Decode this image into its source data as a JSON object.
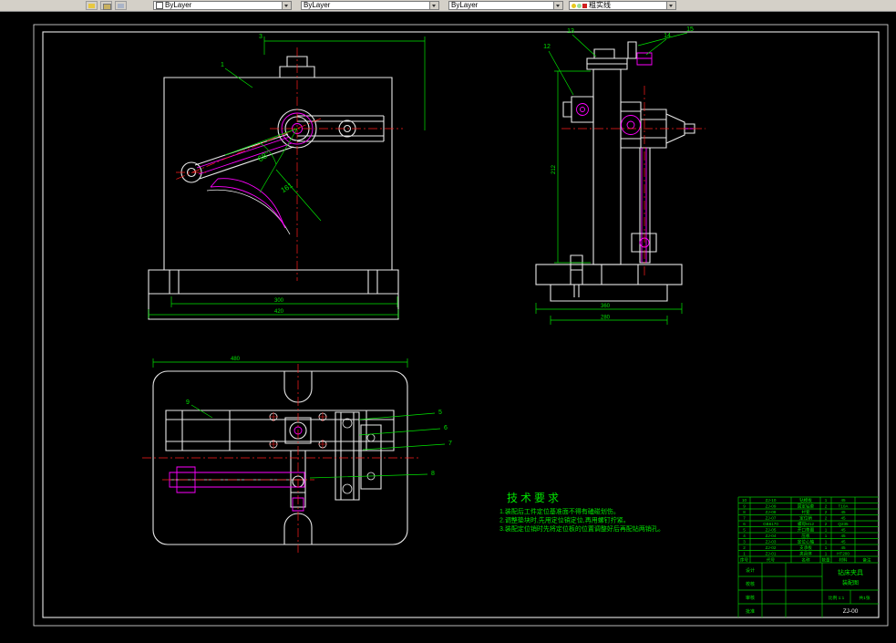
{
  "toolbar": {
    "combos": [
      {
        "value": "ByLayer"
      },
      {
        "value": "ByLayer"
      },
      {
        "value": "ByLayer"
      }
    ],
    "layer_combo": {
      "value": "粗实线"
    }
  },
  "front_view": {
    "balloons": {
      "b1": "1",
      "b3": "3"
    },
    "dims": {
      "angle": "68°",
      "radius": "161",
      "base_inner": "300",
      "base_outer": "420"
    }
  },
  "side_view": {
    "balloons": {
      "b12": "12",
      "b13": "13",
      "b14": "14",
      "b15": "15"
    },
    "dims": {
      "base": "360",
      "base_inner": "280",
      "height": "212"
    }
  },
  "top_view": {
    "balloons": {
      "b5": "5",
      "b6": "6",
      "b7": "7",
      "b8": "8",
      "b9": "9"
    },
    "dims": {
      "width": "480"
    }
  },
  "tech_requirements": {
    "title": "技术要求",
    "items": [
      "1.装配后工件定位基准面不得有磕碰划伤。",
      "2.调整垫块时,先用定位销定位,再用螺钉拧紧。",
      "3.装配定位销时先将定位板的位置调整好后再配钻两销孔。"
    ]
  },
  "title_block": {
    "header": {
      "no": "序号",
      "code": "代号",
      "name": "名称",
      "qty": "数量",
      "mat": "材料",
      "note": "备注"
    },
    "parts": [
      {
        "no": "10",
        "code": "ZJ-10",
        "name": "钻模板",
        "qty": "1",
        "mat": "45"
      },
      {
        "no": "9",
        "code": "ZJ-09",
        "name": "固定钻套",
        "qty": "2",
        "mat": "T10A"
      },
      {
        "no": "8",
        "code": "ZJ-08",
        "name": "衬套",
        "qty": "2",
        "mat": "45"
      },
      {
        "no": "7",
        "code": "ZJ-07",
        "name": "定位销",
        "qty": "2",
        "mat": "45"
      },
      {
        "no": "6",
        "code": "GB6170",
        "name": "螺母M12",
        "qty": "2",
        "mat": "Q235"
      },
      {
        "no": "5",
        "code": "ZJ-05",
        "name": "开口垫圈",
        "qty": "1",
        "mat": "45"
      },
      {
        "no": "4",
        "code": "ZJ-04",
        "name": "压板",
        "qty": "1",
        "mat": "45"
      },
      {
        "no": "3",
        "code": "ZJ-03",
        "name": "定位心轴",
        "qty": "1",
        "mat": "45"
      },
      {
        "no": "2",
        "code": "ZJ-02",
        "name": "支承板",
        "qty": "1",
        "mat": "45"
      },
      {
        "no": "1",
        "code": "ZJ-01",
        "name": "夹具体",
        "qty": "1",
        "mat": "HT200"
      }
    ],
    "sign_labels": [
      "设计",
      "校核",
      "审核",
      "批准"
    ],
    "title_line1": "钻床夹具",
    "title_line2": "装配图",
    "scale": "比例 1:1",
    "sheets": "共1张",
    "number": "ZJ-00"
  }
}
